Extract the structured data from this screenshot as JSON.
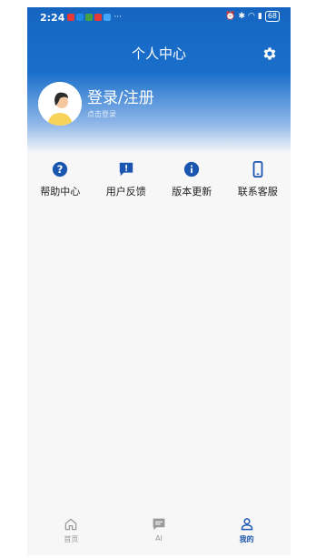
{
  "status_bar": {
    "time": "2:24",
    "overflow": "···",
    "battery": "68"
  },
  "header": {
    "title": "个人中心",
    "settings_icon": "gear-icon"
  },
  "profile": {
    "title": "登录/注册",
    "subtitle": "点击登录"
  },
  "quick_actions": [
    {
      "label": "帮助中心",
      "icon": "help-icon"
    },
    {
      "label": "用户反馈",
      "icon": "feedback-icon"
    },
    {
      "label": "版本更新",
      "icon": "info-icon"
    },
    {
      "label": "联系客服",
      "icon": "phone-icon"
    }
  ],
  "tabs": [
    {
      "label": "首页",
      "icon": "home-icon"
    },
    {
      "label": "AI",
      "icon": "chat-icon"
    },
    {
      "label": "我的",
      "icon": "user-icon"
    }
  ],
  "colors": {
    "accent": "#1565c0",
    "icon": "#1a55b0",
    "tab_inactive": "#999999"
  }
}
